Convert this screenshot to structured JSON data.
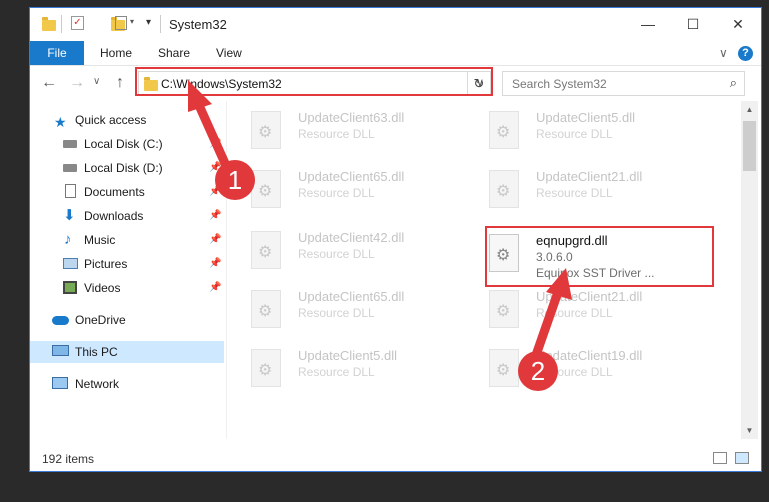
{
  "window": {
    "title": "System32",
    "controls": {
      "minimize": "—",
      "maximize": "☐",
      "close": "✕"
    }
  },
  "ribbon": {
    "tabs": [
      "File",
      "Home",
      "Share",
      "View"
    ],
    "expand": "∨",
    "help": "?"
  },
  "nav": {
    "back": "←",
    "forward": "→",
    "recent": "∨",
    "up": "↑",
    "address": "C:\\Windows\\System32",
    "address_dropdown": "∨",
    "refresh": "↻",
    "search_placeholder": "Search System32",
    "search_icon": "⌕"
  },
  "sidebar": {
    "items": [
      {
        "label": "Quick access",
        "icon": "star-icon",
        "pinned": false
      },
      {
        "label": "Local Disk (C:)",
        "icon": "drive-icon",
        "pinned": true
      },
      {
        "label": "Local Disk (D:)",
        "icon": "drive-icon",
        "pinned": true
      },
      {
        "label": "Documents",
        "icon": "document-icon",
        "pinned": true
      },
      {
        "label": "Downloads",
        "icon": "download-icon",
        "pinned": true
      },
      {
        "label": "Music",
        "icon": "music-icon",
        "pinned": true
      },
      {
        "label": "Pictures",
        "icon": "picture-icon",
        "pinned": true
      },
      {
        "label": "Videos",
        "icon": "video-icon",
        "pinned": true
      },
      {
        "label": "OneDrive",
        "icon": "cloud-icon",
        "pinned": false
      },
      {
        "label": "This PC",
        "icon": "computer-icon",
        "pinned": false,
        "selected": true
      },
      {
        "label": "Network",
        "icon": "network-icon",
        "pinned": false
      }
    ],
    "pin_glyph": "📌"
  },
  "files": {
    "left": [
      {
        "name": "UpdateClient63.dll",
        "desc": "Resource DLL"
      },
      {
        "name": "UpdateClient65.dll",
        "desc": "Resource DLL"
      },
      {
        "name": "UpdateClient42.dll",
        "desc": "Resource DLL"
      },
      {
        "name": "UpdateClient65.dll",
        "desc": "Resource DLL"
      },
      {
        "name": "UpdateClient5.dll",
        "desc": "Resource DLL"
      }
    ],
    "right": [
      {
        "name": "UpdateClient5.dll",
        "desc": "Resource DLL"
      },
      {
        "name": "UpdateClient21.dll",
        "desc": "Resource DLL"
      },
      {
        "name": "UpdateClient21.dll",
        "desc": "Resource DLL"
      },
      {
        "name": "UpdateClient19.dll",
        "desc": "Resource DLL"
      }
    ],
    "highlighted": {
      "name": "eqnupgrd.dll",
      "version": "3.0.6.0",
      "desc": "Equinox SST Driver ..."
    }
  },
  "status": {
    "count": "192 items"
  },
  "annotations": {
    "step1": "1",
    "step2": "2",
    "color": "#e0383b"
  }
}
